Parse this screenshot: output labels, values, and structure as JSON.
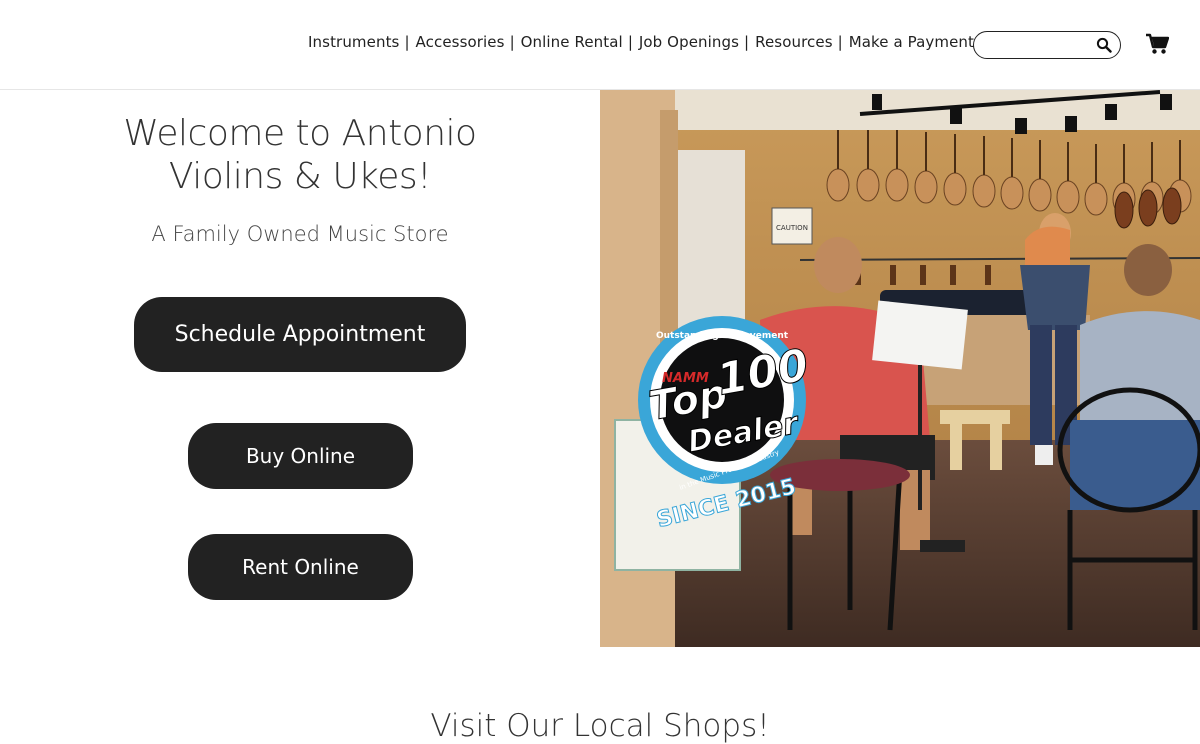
{
  "header": {
    "nav": [
      {
        "label": "Instruments"
      },
      {
        "label": "Accessories"
      },
      {
        "label": "Online Rental"
      },
      {
        "label": "Job Openings"
      },
      {
        "label": "Resources"
      },
      {
        "label": "Make a Payment"
      }
    ],
    "separator": "|",
    "search": {
      "placeholder": "",
      "value": "",
      "icon": "search-icon"
    },
    "cart": {
      "icon": "cart-icon"
    }
  },
  "hero": {
    "title_line1": "Welcome to Antonio",
    "title_line2": "Violins & Ukes!",
    "subtitle": "A Family Owned Music Store",
    "buttons": {
      "schedule": "Schedule Appointment",
      "buy": "Buy Online",
      "rent": "Rent Online"
    },
    "badge": {
      "top_arc": "Outstanding Achievement",
      "namm": "NAMM",
      "top": "Top",
      "number": "100",
      "dealer": "Dealer",
      "bottom_arc": "in the Music Products Industry",
      "since": "SINCE 2015"
    },
    "sign_text": "CAUTION"
  },
  "section": {
    "title": "Visit Our Local Shops!"
  },
  "colors": {
    "button_bg": "#222222",
    "button_text": "#ffffff",
    "badge_ring": "#3aa6d8",
    "badge_red": "#d62a2a",
    "wall": "#b98a4e"
  }
}
